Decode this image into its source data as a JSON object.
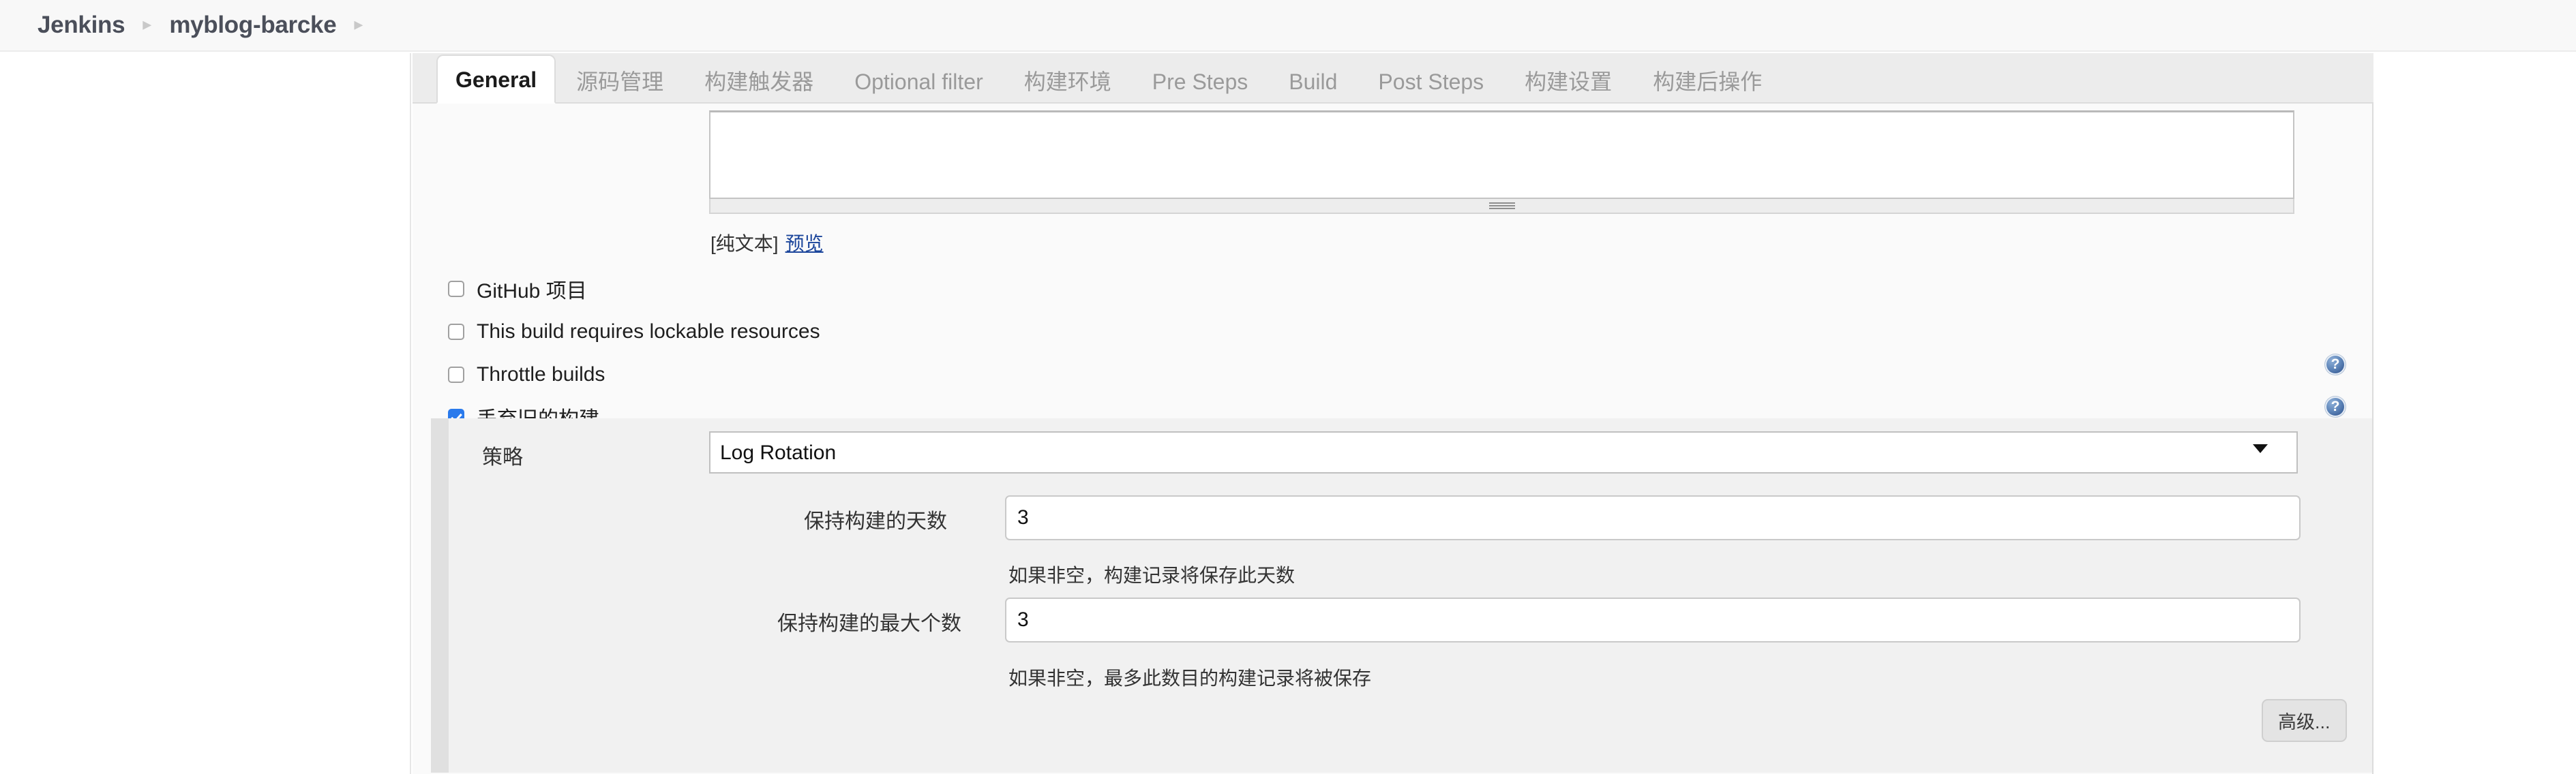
{
  "breadcrumb": {
    "items": [
      {
        "label": "Jenkins"
      },
      {
        "label": "myblog-barcke"
      }
    ],
    "separator": "▸"
  },
  "tabs": [
    {
      "label": "General",
      "active": true
    },
    {
      "label": "源码管理",
      "active": false
    },
    {
      "label": "构建触发器",
      "active": false
    },
    {
      "label": "Optional filter",
      "active": false
    },
    {
      "label": "构建环境",
      "active": false
    },
    {
      "label": "Pre Steps",
      "active": false
    },
    {
      "label": "Build",
      "active": false
    },
    {
      "label": "Post Steps",
      "active": false
    },
    {
      "label": "构建设置",
      "active": false
    },
    {
      "label": "构建后操作",
      "active": false
    }
  ],
  "description": {
    "value": "",
    "placeholder": "",
    "plain_text_note": "[纯文本]",
    "preview_link": "预览"
  },
  "checkboxes": [
    {
      "label": "GitHub 项目",
      "checked": false,
      "help": false
    },
    {
      "label": "This build requires lockable resources",
      "checked": false,
      "help": false
    },
    {
      "label": "Throttle builds",
      "checked": false,
      "help": true
    },
    {
      "label": "丢弃旧的构建",
      "checked": true,
      "help": true
    }
  ],
  "help_icon_glyph": "?",
  "policy_section": {
    "strategy_label": "策略",
    "strategy_value": "Log Rotation",
    "strategy_options": [
      "Log Rotation"
    ],
    "fields": [
      {
        "label": "保持构建的天数",
        "value": "3",
        "hint": "如果非空，构建记录将保存此天数"
      },
      {
        "label": "保持构建的最大个数",
        "value": "3",
        "hint": "如果非空，最多此数目的构建记录将被保存"
      }
    ],
    "advanced_button": "高级..."
  },
  "colors": {
    "accent_checkbox": "#2a7aec",
    "link": "#1b459b",
    "breadcrumb_text": "#4b4f5a",
    "tab_inactive": "#9a9a9a",
    "block_background": "#f1f1f1"
  }
}
